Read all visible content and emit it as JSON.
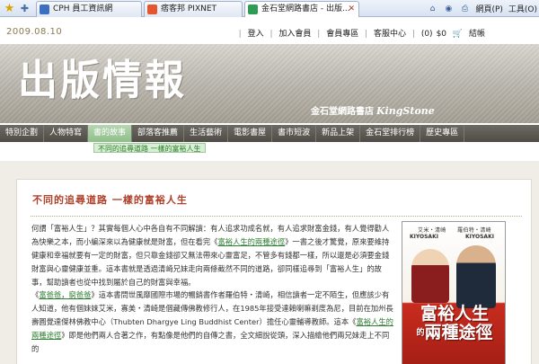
{
  "browser": {
    "tabs": [
      {
        "label": "CPH 員工資訊網",
        "active": false
      },
      {
        "label": "痞客邦 PIXNET",
        "active": false
      },
      {
        "label": "金石堂網路書店 - 出版...",
        "active": true
      }
    ],
    "tools": {
      "web": "網頁(P)",
      "tools": "工具(O)"
    }
  },
  "header": {
    "date": "2009.08.10",
    "links": {
      "login": "登入",
      "join": "加入會員",
      "member_area": "會員專區",
      "service": "客服中心",
      "cart_count": "(0)",
      "cart_amount": "$0",
      "checkout": "結帳"
    }
  },
  "banner": {
    "logo": "出版情報",
    "sub": "金石堂網路書店",
    "brand": "KingStone"
  },
  "nav": {
    "items": [
      "特別企劃",
      "人物特寫",
      "書的故事",
      "部落客推薦",
      "生活藝術",
      "電影書屋",
      "書市短波",
      "新品上架",
      "金石堂排行榜",
      "歷史專區"
    ],
    "active_index": 2,
    "sub": "不同的追尋道路 一樣的富裕人生"
  },
  "article": {
    "title": "不同的追尋道路 一樣的富裕人生",
    "p1_pre": "何謂「富裕人生」？其實每個人心中各自有不同解讀：有人追求功成名就，有人追求財富金錢，有人覺得勸人為快樂之本，而小編深來以為健康就是財富，但在看完《",
    "p1_link": "富裕人生的兩種途徑",
    "p1_post": "》一書之後才驚覺，原來要維持健康和幸福就要有一定的財富，但只靠金錢卻又無法帶來心靈富足，不管多有錢都一樣，所以還是必須要金錢財富與心靈健康並重。這本書就是透過清崎兄妹走向兩條截然不同的道路，卻同樣追尋到「富裕人生」的故事，幫助讀者也從中找到屬於自己的財富與幸福。",
    "p2_link1": "富爸爸，窮爸爸",
    "p2_mid": "》這本書問世風靡國際市場的暢銷書作者羅伯特・清崎，相信讀者一定不陌生，但應該少有人知道，他有個妹妹艾米，寡美・清崎是個藏傳佛教修行人，在1985年接受達賴喇嘛剃度為尼，目前在加州長壽圓覺達傑林佛教中心（Thubten Dhargye Ling Buddhist Center）擔任心靈輔導教師。這本《",
    "p2_link2": "富裕人生的兩種途徑",
    "p2_post": "》即是他們兩人合著之作，有點像是他們的自傳之書，全文細說從頭，深入描繪他們兩兄妹走上不同的"
  },
  "book": {
    "names": "艾米・清崎　　羅伯特・清崎",
    "kiyosaki_left": "KIYOSAKI",
    "kiyosaki_right": "KIYOSAKI",
    "title_a": "富裕人生",
    "title_de": "的",
    "title_b": "兩種途徑"
  }
}
